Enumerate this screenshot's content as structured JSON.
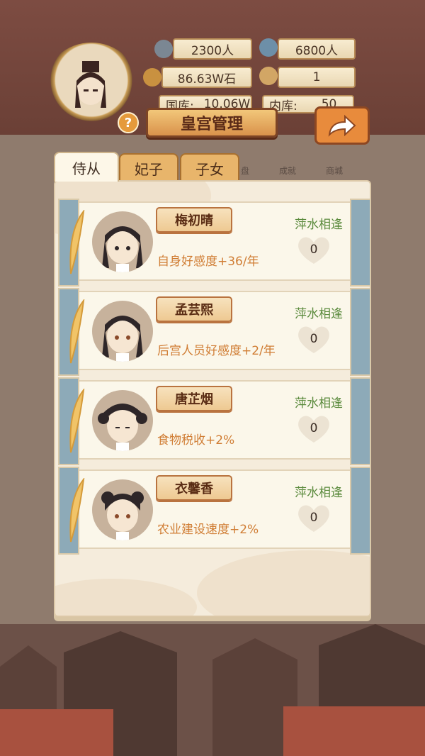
{
  "header": {
    "stats": {
      "soldiers": "2300人",
      "population": "6800人",
      "grain": "86.63W石",
      "item_count": "1",
      "treasury_label": "国库:",
      "treasury_value": "10.06W",
      "inner_label": "内库:",
      "inner_value": "50"
    }
  },
  "title": "皇宫管理",
  "help_glyph": "?",
  "background_menu": [
    "盘",
    "成就",
    "商城"
  ],
  "tabs": [
    {
      "label": "侍从",
      "active": true
    },
    {
      "label": "妃子",
      "active": false
    },
    {
      "label": "子女",
      "active": false
    }
  ],
  "attendants": [
    {
      "name": "梅初晴",
      "effect": "自身好感度+36/年",
      "status": "萍水相逢",
      "affection": "0"
    },
    {
      "name": "孟芸熙",
      "effect": "后宫人员好感度+2/年",
      "status": "萍水相逢",
      "affection": "0"
    },
    {
      "name": "唐芷烟",
      "effect": "食物税收+2%",
      "status": "萍水相逢",
      "affection": "0"
    },
    {
      "name": "衣馨香",
      "effect": "农业建设速度+2%",
      "status": "萍水相逢",
      "affection": "0"
    }
  ],
  "colors": {
    "accent": "#e88b3c",
    "status_green": "#5a8a3c",
    "effect_orange": "#d07d34",
    "strip_blue": "#8daab8"
  },
  "icons": {
    "soldier": "helmet-icon",
    "population": "person-icon",
    "grain": "grain-icon",
    "item": "scroll-icon",
    "share": "share-arrow-icon",
    "help": "question-icon",
    "heart": "heart-icon"
  }
}
